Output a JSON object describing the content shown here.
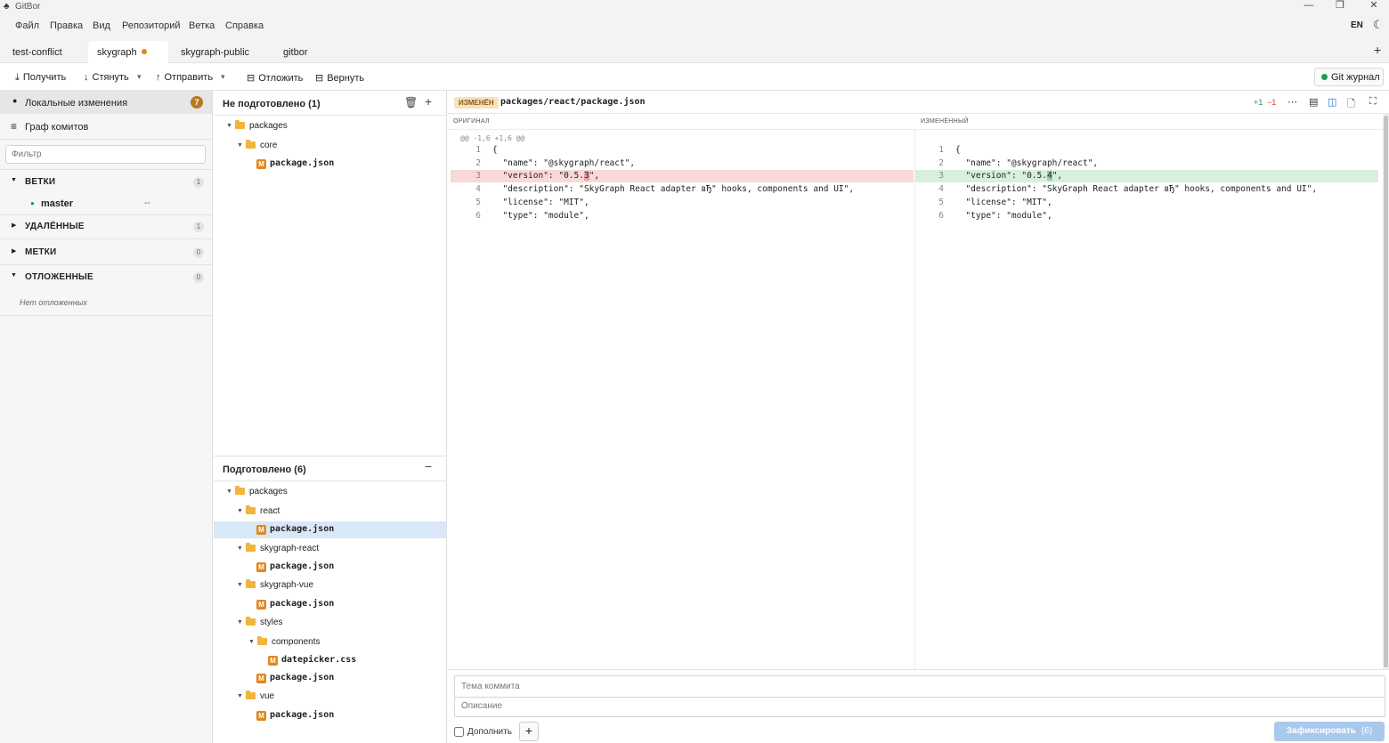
{
  "window": {
    "title": "GitBor",
    "minimize": "—",
    "maximize": "❐",
    "close": "✕"
  },
  "menu": {
    "items": [
      "Файл",
      "Правка",
      "Вид",
      "Репозиторий",
      "Ветка",
      "Справка"
    ],
    "lang": "EN",
    "theme_icon": "moon-icon"
  },
  "tabs": {
    "items": [
      {
        "label": "test-conflict",
        "active": false,
        "modified": false
      },
      {
        "label": "skygraph",
        "active": true,
        "modified": true
      },
      {
        "label": "skygraph-public",
        "active": false,
        "modified": false
      },
      {
        "label": "gitbor",
        "active": false,
        "modified": false
      }
    ],
    "add": "+"
  },
  "toolbar": {
    "fetch": "Получить",
    "pull": "Стянуть",
    "push": "Отправить",
    "stash": "Отложить",
    "restore": "Вернуть",
    "git_log": "Git журнал"
  },
  "sidebar": {
    "local_changes": "Локальные изменения",
    "local_changes_count": "7",
    "commit_graph": "Граф комитов",
    "filter_placeholder": "Фильтр",
    "sections": {
      "branches": {
        "title": "ВЕТКИ",
        "count": "1",
        "expanded": true
      },
      "remotes": {
        "title": "УДАЛЁННЫЕ",
        "count": "1",
        "expanded": false
      },
      "tags": {
        "title": "МЕТКИ",
        "count": "0",
        "expanded": false
      },
      "stashes": {
        "title": "ОТЛОЖЕННЫЕ",
        "count": "0",
        "expanded": true
      }
    },
    "branch_master": "master",
    "branch_marker": "--",
    "no_stashes": "Нет отложенных"
  },
  "unstaged": {
    "title": "Не подготовлено (1)",
    "tree": [
      {
        "type": "folder",
        "name": "packages",
        "depth": 0
      },
      {
        "type": "folder",
        "name": "core",
        "depth": 1
      },
      {
        "type": "file",
        "name": "package.json",
        "depth": 2,
        "status": "M"
      }
    ]
  },
  "staged": {
    "title": "Подготовлено (6)",
    "tree": [
      {
        "type": "folder",
        "name": "packages",
        "depth": 0
      },
      {
        "type": "folder",
        "name": "react",
        "depth": 1
      },
      {
        "type": "file",
        "name": "package.json",
        "depth": 2,
        "status": "M",
        "selected": true
      },
      {
        "type": "folder",
        "name": "skygraph-react",
        "depth": 1
      },
      {
        "type": "file",
        "name": "package.json",
        "depth": 2,
        "status": "M"
      },
      {
        "type": "folder",
        "name": "skygraph-vue",
        "depth": 1
      },
      {
        "type": "file",
        "name": "package.json",
        "depth": 2,
        "status": "M"
      },
      {
        "type": "folder",
        "name": "styles",
        "depth": 1
      },
      {
        "type": "folder",
        "name": "components",
        "depth": 2
      },
      {
        "type": "file",
        "name": "datepicker.css",
        "depth": 3,
        "status": "M"
      },
      {
        "type": "file",
        "name": "package.json",
        "depth": 2,
        "status": "M"
      },
      {
        "type": "folder",
        "name": "vue",
        "depth": 1
      },
      {
        "type": "file",
        "name": "package.json",
        "depth": 2,
        "status": "M"
      }
    ]
  },
  "diff": {
    "status": "ИЗМЕНЁН",
    "path": "packages/react/package.json",
    "additions": "+1",
    "deletions": "−1",
    "left_header": "ОРИГИНАЛ",
    "right_header": "ИЗМЕНЁННЫЙ",
    "hunk": "@@ -1,6 +1,6 @@",
    "left": [
      {
        "n": "1",
        "t": "{"
      },
      {
        "n": "2",
        "t": "  \"name\": \"@skygraph/react\","
      },
      {
        "n": "3",
        "pre": "  \"version\": \"0.5.",
        "chg": "3",
        "post": "\",",
        "kind": "del"
      },
      {
        "n": "4",
        "t": "  \"description\": \"SkyGraph React adapter вЂ\" hooks, components and UI\","
      },
      {
        "n": "5",
        "t": "  \"license\": \"MIT\","
      },
      {
        "n": "6",
        "t": "  \"type\": \"module\","
      }
    ],
    "right": [
      {
        "n": "1",
        "t": "{"
      },
      {
        "n": "2",
        "t": "  \"name\": \"@skygraph/react\","
      },
      {
        "n": "3",
        "pre": "  \"version\": \"0.5.",
        "chg": "4",
        "post": "\",",
        "kind": "add"
      },
      {
        "n": "4",
        "t": "  \"description\": \"SkyGraph React adapter вЂ\" hooks, components and UI\","
      },
      {
        "n": "5",
        "t": "  \"license\": \"MIT\","
      },
      {
        "n": "6",
        "t": "  \"type\": \"module\","
      }
    ]
  },
  "commit": {
    "subject_placeholder": "Тема коммита",
    "description_placeholder": "Описание",
    "amend_label": "Дополнить",
    "add_button": "+",
    "commit_button": "Зафиксировать",
    "commit_count": "(6)"
  },
  "colors": {
    "accent": "#1f6fd1",
    "modified": "#e0871c",
    "deleted_bg": "#f9d8d8",
    "added_bg": "#d8efdc",
    "commit_button": "#a9c9ec"
  }
}
